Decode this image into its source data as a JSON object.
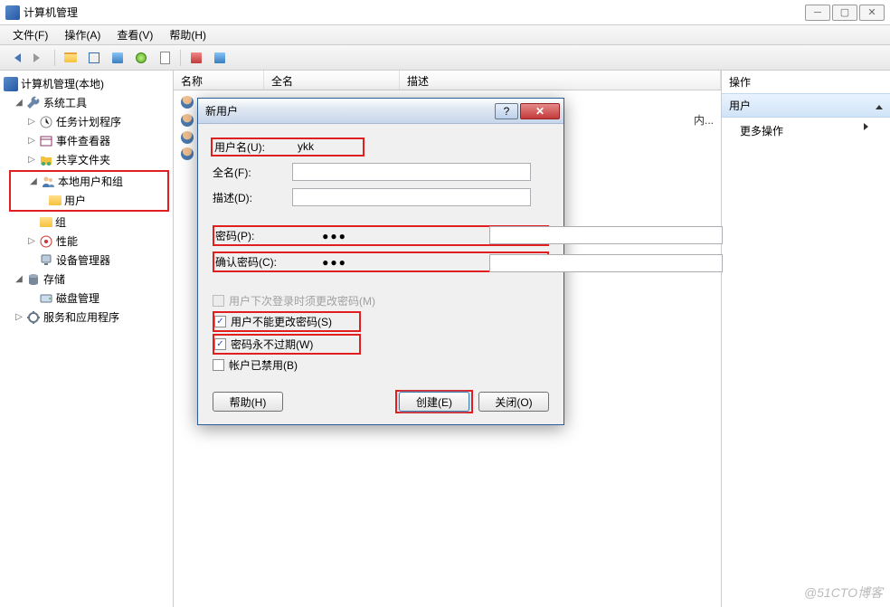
{
  "window": {
    "title": "计算机管理"
  },
  "menubar": {
    "file": "文件(F)",
    "action": "操作(A)",
    "view": "查看(V)",
    "help": "帮助(H)"
  },
  "tree": {
    "root": "计算机管理(本地)",
    "system_tools": "系统工具",
    "task_scheduler": "任务计划程序",
    "event_viewer": "事件查看器",
    "shared_folders": "共享文件夹",
    "local_users_groups": "本地用户和组",
    "users": "用户",
    "groups": "组",
    "performance": "性能",
    "device_manager": "设备管理器",
    "storage": "存储",
    "disk_management": "磁盘管理",
    "services": "服务和应用程序"
  },
  "list": {
    "col_name": "名称",
    "col_fullname": "全名",
    "col_description": "描述",
    "partial_desc": "内..."
  },
  "actions": {
    "header": "操作",
    "section": "用户",
    "more": "更多操作"
  },
  "dialog": {
    "title": "新用户",
    "username_label": "用户名(U):",
    "username_value": "ykk",
    "fullname_label": "全名(F):",
    "fullname_value": "",
    "description_label": "描述(D):",
    "description_value": "",
    "password_label": "密码(P):",
    "password_value": "●●●",
    "confirm_label": "确认密码(C):",
    "confirm_value": "●●●",
    "chk_must_change": "用户下次登录时须更改密码(M)",
    "chk_cannot_change": "用户不能更改密码(S)",
    "chk_never_expires": "密码永不过期(W)",
    "chk_disabled": "帐户已禁用(B)",
    "btn_help": "帮助(H)",
    "btn_create": "创建(E)",
    "btn_close": "关闭(O)"
  },
  "watermark": "@51CTO博客"
}
